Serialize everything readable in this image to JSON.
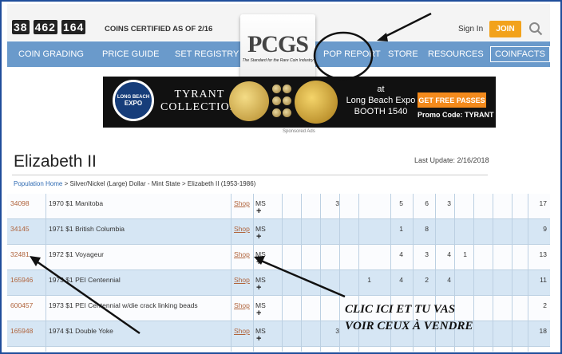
{
  "header": {
    "counter_groups": [
      "38",
      "462",
      "164"
    ],
    "certified_label": "COINS CERTIFIED AS OF 2/16",
    "sign_in": "Sign In",
    "join": "JOIN",
    "search_icon": "search-icon"
  },
  "logo": {
    "text": "PCGS",
    "tagline": "The Standard for the Rare Coin Industry"
  },
  "nav": {
    "items": [
      "COIN GRADING",
      "PRICE GUIDE",
      "SET REGISTRY",
      "POP REPORT",
      "STORE",
      "RESOURCES",
      "COINFACTS"
    ]
  },
  "ad": {
    "badge_line1": "LONG BEACH",
    "badge_line2": "EXPO",
    "collection_line1": "TYRANT",
    "collection_line2": "COLLECTION",
    "at_line1": "at",
    "at_line2": "Long Beach Expo",
    "at_line3": "BOOTH 1540",
    "cta": "GET FREE PASSES",
    "promo": "Promo Code: TYRANT",
    "sponsored": "Sponsored Ads"
  },
  "page": {
    "title": "Elizabeth II",
    "last_update": "Last Update: 2/16/2018",
    "breadcrumb": [
      "Population Home",
      "Silver/Nickel (Large) Dollar - Mint State",
      "Elizabeth II (1953-1986)"
    ],
    "breadcrumb_separator": ">"
  },
  "table": {
    "shop_label": "Shop",
    "grade_label": "MS",
    "plus_label": "+",
    "rows": [
      {
        "id": "34098",
        "desc": "1970 $1 Manitoba",
        "counts": [
          "",
          "",
          "",
          "3",
          "",
          "5",
          "6",
          "3",
          "",
          "",
          "",
          "17"
        ]
      },
      {
        "id": "34145",
        "desc": "1971 $1 British Columbia",
        "counts": [
          "",
          "",
          "",
          "",
          "",
          "1",
          "8",
          "",
          "",
          "",
          "",
          "9"
        ]
      },
      {
        "id": "32481",
        "desc": "1972 $1 Voyageur",
        "counts": [
          "",
          "",
          "",
          "",
          "",
          "4",
          "3",
          "4",
          "1",
          "",
          "",
          "13"
        ]
      },
      {
        "id": "165946",
        "desc": "1973 $1 PEI Centennial",
        "counts": [
          "",
          "",
          "",
          "",
          "1",
          "4",
          "2",
          "4",
          "",
          "",
          "",
          "11"
        ]
      },
      {
        "id": "600457",
        "desc": "1973 $1 PEI Centennial w/die crack linking beads",
        "counts": [
          "",
          "",
          "",
          "",
          "",
          "",
          "",
          "",
          "",
          "",
          "",
          "2"
        ]
      },
      {
        "id": "165948",
        "desc": "1974 $1 Double Yoke",
        "counts": [
          "",
          "",
          "",
          "3",
          "",
          "",
          "",
          "",
          "",
          "",
          "",
          "18"
        ]
      }
    ]
  },
  "annotation": {
    "caption_line1": "CLIC ICI ET TU VAS",
    "caption_line2": "VOIR CEUX À VENDRE"
  }
}
